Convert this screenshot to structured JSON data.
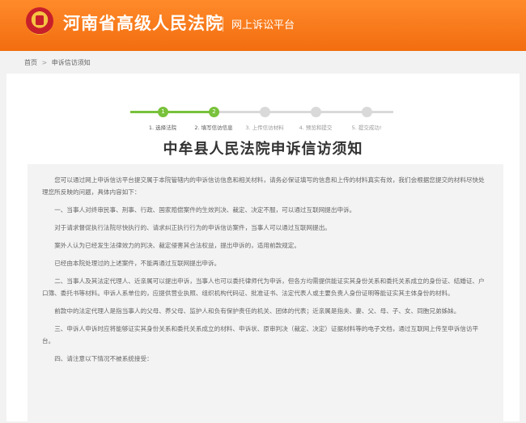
{
  "header": {
    "court_name": "河南省高级人民法院",
    "platform_name": "网上诉讼平台"
  },
  "breadcrumb": {
    "home": "首页",
    "separator": ">",
    "current": "申诉信访须知"
  },
  "steps": {
    "items": [
      {
        "number": "1",
        "label": "1. 选择法院",
        "state": "done"
      },
      {
        "number": "2",
        "label": "2. 填写信访信息",
        "state": "done"
      },
      {
        "number": "3",
        "label": "3. 上传信访材料",
        "state": "todo"
      },
      {
        "number": "4",
        "label": "4. 预览和提交",
        "state": "todo"
      },
      {
        "number": "5",
        "label": "5. 提交成功!",
        "state": "todo"
      }
    ],
    "done_color": "#78c23b",
    "todo_color": "#d9d9d9"
  },
  "notice": {
    "title": "中牟县人民法院申诉信访须知",
    "paragraphs": [
      "您可以通过网上申诉信访平台提交属于本院管辖内的申诉信访信息和相关材料，请务必保证填写的信息和上传的材料真实有效，我们会根据您提交的材料尽快处理您所反映的问题，具体内容如下：",
      "一、当事人对终审民事、刑事、行政、国家赔偿案件的生效判决、裁定、决定不服，可以通过互联网提出申诉。",
      "对于请求督促执行法院尽快执行的、请求纠正执行行为的申诉信访案件，当事人可以通过互联网提出。",
      "案外人认为已经发生法律效力的判决、裁定侵害其合法权益，提出申诉的，适用前款规定。",
      "已经由本院处理过的上述案件，不能再通过互联网提出申诉。",
      "二、当事人及其法定代理人、近亲属可以提出申诉，当事人也可以委托律师代为申诉，但各方均需提供能证实其身份关系和委托关系成立的身份证、结婚证、户口簿、委托书等材料。申诉人系单位的，应提供营业执照、组织机构代码证、批准证书、法定代表人或主要负责人身份证明等能证实其主体身份的材料。",
      "前款中的法定代理人是指当事人的父母、养父母、监护人和负有保护责任的机关、团体的代表；近亲属是指夫、妻、父、母、子、女、同胞兄弟姊妹。",
      "三、申诉人申诉时应将能够证实其身份关系和委托关系成立的材料、申诉状、原审判决（裁定、决定）证据材料等的电子文档，通过互联网上传至申诉信访平台。",
      "四、请注意以下情况不被系统接受："
    ]
  }
}
